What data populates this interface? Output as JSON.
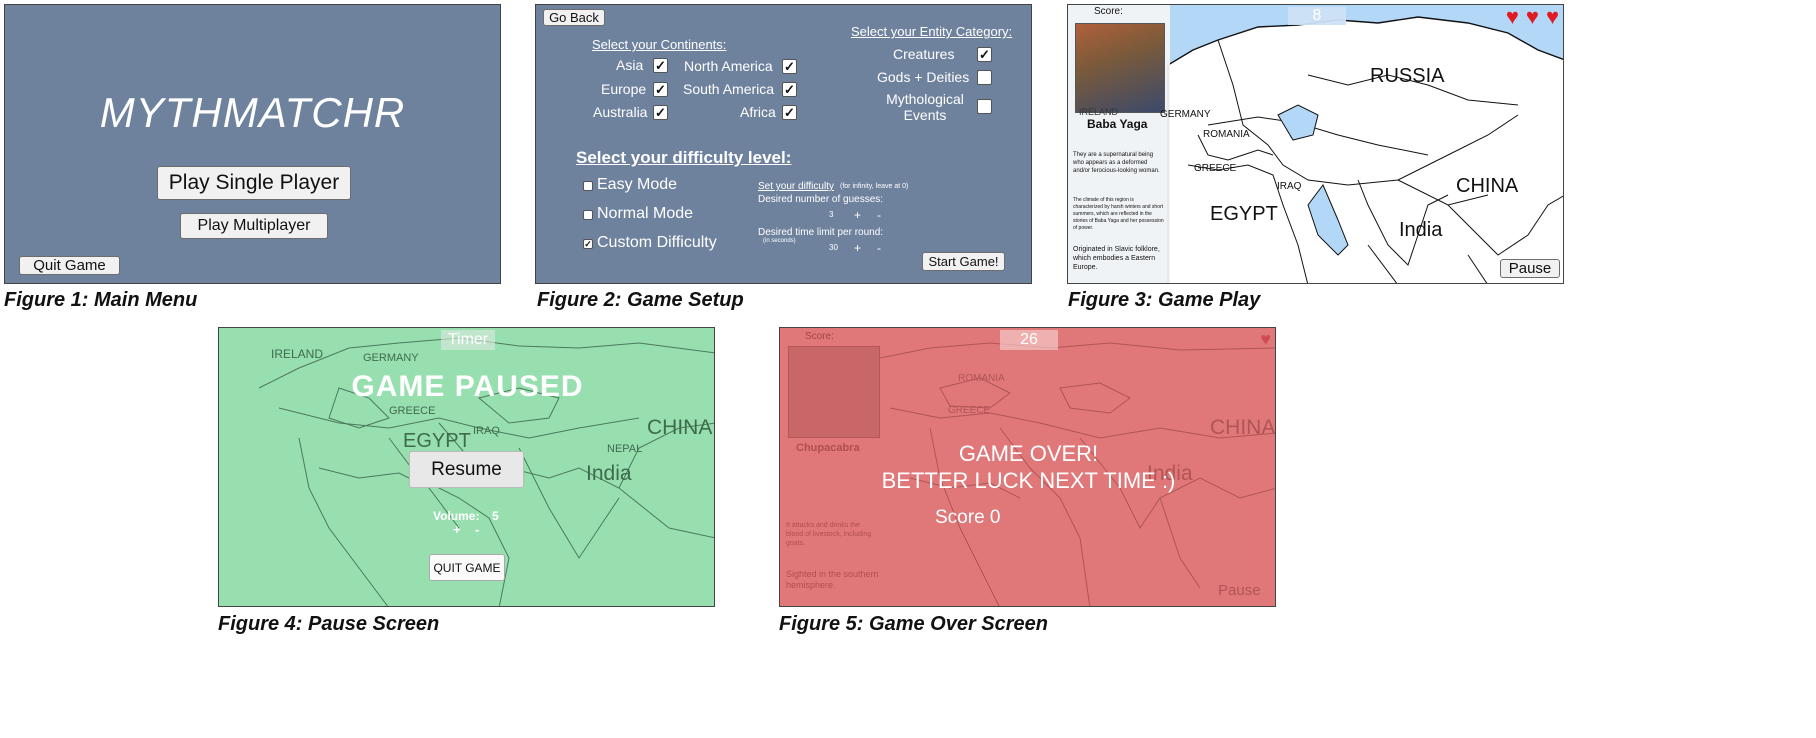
{
  "colors": {
    "menu_bg": "#6e829e",
    "map_water": "#b3d7f6",
    "map_land": "#ffffff",
    "pause_overlay": "#98dfb0",
    "gameover_overlay": "#e0787a",
    "heart": "#e01b24"
  },
  "figures": [
    {
      "caption": "Figure 1: Main Menu"
    },
    {
      "caption": "Figure 2: Game Setup"
    },
    {
      "caption": "Figure 3: Game Play"
    },
    {
      "caption": "Figure 4: Pause Screen"
    },
    {
      "caption": "Figure 5: Game Over Screen"
    }
  ],
  "main_menu": {
    "title": "MYTHMATCHR",
    "single_player": "Play Single Player",
    "multiplayer": "Play Multiplayer",
    "quit": "Quit Game"
  },
  "setup": {
    "go_back": "Go Back",
    "continents_heading": "Select your Continents:",
    "continents": [
      {
        "name": "Asia",
        "checked": true
      },
      {
        "name": "North America",
        "checked": true
      },
      {
        "name": "Europe",
        "checked": true
      },
      {
        "name": "South America",
        "checked": true
      },
      {
        "name": "Australia",
        "checked": true
      },
      {
        "name": "Africa",
        "checked": true
      }
    ],
    "category_heading": "Select your Entity Category:",
    "categories": [
      {
        "name": "Creatures",
        "checked": true
      },
      {
        "name": "Gods + Deities",
        "checked": false
      },
      {
        "name": "Mythological Events",
        "checked": false
      }
    ],
    "difficulty_heading": "Select your difficulty level:",
    "modes": [
      {
        "name": "Easy Mode",
        "checked": false
      },
      {
        "name": "Normal Mode",
        "checked": false
      },
      {
        "name": "Custom Difficulty",
        "checked": true
      }
    ],
    "set_difficulty": "Set your difficulty",
    "infinity_note": "(for infinity, leave at 0)",
    "guesses_label": "Desired number of guesses:",
    "guesses_value": "3",
    "time_label": "Desired time limit per round:",
    "time_note": "(in seconds)",
    "time_value": "30",
    "plus": "+",
    "minus": "-",
    "start": "Start Game!"
  },
  "gameplay": {
    "score_label": "Score:",
    "score_value": "8",
    "hearts": 3,
    "entity_name": "Baba Yaga",
    "desc1": "They are a supernatural being who appears as a deformed and/or ferocious-looking woman.",
    "desc2": "The climate of this region is characterized by harsh winters and short summers, which are reflected in the stories of Baba Yaga and her possession of power.",
    "desc3": "Originated in Slavic folklore, which embodies a Eastern Europe.",
    "pause": "Pause",
    "countries": {
      "russia": "RUSSIA",
      "china": "CHINA",
      "egypt": "EGYPT",
      "india": "India",
      "germany": "GERMANY",
      "romania": "ROMANIA",
      "greece": "GREECE",
      "iraq": "IRAQ",
      "ireland": "IRELAND"
    }
  },
  "pause_screen": {
    "timer": "Timer",
    "title": "GAME PAUSED",
    "resume": "Resume",
    "volume_label": "Volume:",
    "volume_value": "5",
    "plus": "+",
    "minus": "-",
    "quit": "QUIT GAME",
    "countries": {
      "ireland": "IRELAND",
      "germany": "GERMANY",
      "greece": "GREECE",
      "iraq": "IRAQ",
      "nepal": "NEPAL",
      "china": "CHINA",
      "india": "India",
      "egypt": "EGYPT"
    }
  },
  "gameover": {
    "score_label": "Score:",
    "score_value": "26",
    "entity_name": "Chupacabra",
    "desc1": "It attacks and drinks the blood of livestock, including goats.",
    "desc2": "Sighted in the southern hemisphere.",
    "line1": "GAME OVER!",
    "line2": "BETTER LUCK NEXT TIME :)",
    "final_score": "Score 0",
    "pause": "Pause",
    "countries": {
      "romania": "ROMANIA",
      "greece": "GREECE",
      "china": "CHINA",
      "india": "India"
    }
  }
}
